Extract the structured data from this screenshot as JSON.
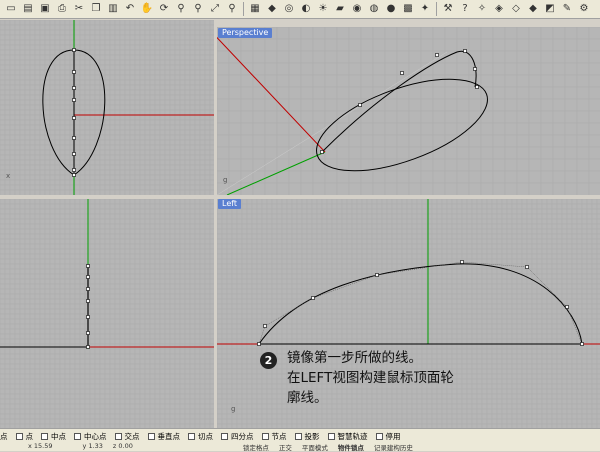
{
  "toolbar": {
    "icons": [
      "new-file-icon",
      "open-file-icon",
      "save-icon",
      "print-icon",
      "cut-icon",
      "copy-icon",
      "paste-icon",
      "undo-icon",
      "pan-icon",
      "rotate-view-icon",
      "zoom-icon",
      "zoom-window-icon",
      "zoom-extents-icon",
      "zoom-selected-icon",
      "grid-icon",
      "car-icon",
      "hide-icon",
      "shade-icon",
      "bulb-icon",
      "layer-icon",
      "color-wheel-icon",
      "render-icon",
      "sphere-icon",
      "options-icon",
      "snap-icon",
      "tool-icon",
      "help-icon",
      "point-on-icon",
      "select-icon",
      "select-box-icon",
      "point-tool-icon",
      "cube-icon",
      "pen-icon",
      "settings-icon"
    ]
  },
  "viewports": {
    "perspective_label": "Perspective",
    "left_label": "Left",
    "top_axis_label": "x",
    "persp_axis_label": "g"
  },
  "annotation": {
    "number": "2",
    "line1": "镜像第一步所做的线。",
    "line2": "在LEFT视图构建鼠标顶面轮",
    "line3": "廓线。"
  },
  "osnaps": [
    {
      "label": "点",
      "checked": false
    },
    {
      "label": "点",
      "checked": false
    },
    {
      "label": "中点",
      "checked": false
    },
    {
      "label": "中心点",
      "checked": false
    },
    {
      "label": "交点",
      "checked": false
    },
    {
      "label": "垂直点",
      "checked": false
    },
    {
      "label": "切点",
      "checked": false
    },
    {
      "label": "四分点",
      "checked": false
    },
    {
      "label": "节点",
      "checked": false
    },
    {
      "label": "投影",
      "checked": false
    },
    {
      "label": "智慧轨迹",
      "checked": false
    },
    {
      "label": "停用",
      "checked": false
    }
  ],
  "status": {
    "x": "x 15.59",
    "y": "y 1.33",
    "z": "z 0.00",
    "mode1": "锁定格点",
    "mode2": "正交",
    "mode3": "平面模式",
    "mode4": "物件锁点",
    "mode5": "记录建构历史"
  },
  "colors": {
    "viewport_bg": "#b6b6b6",
    "grid_line": "#a9a9a9",
    "x_axis": "#c00000",
    "y_axis": "#00a000",
    "curve": "#000000",
    "label_bg": "#5a7fd0"
  }
}
